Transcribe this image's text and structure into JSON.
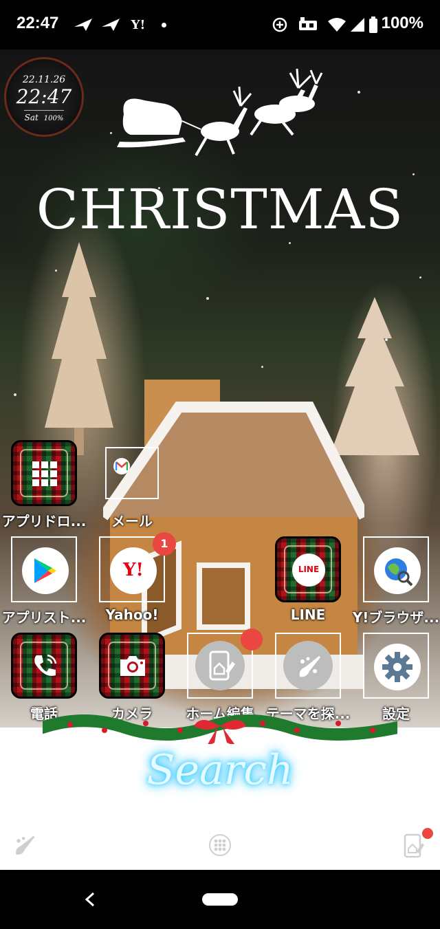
{
  "status_bar": {
    "time": "22:47",
    "left_icons": [
      "paper-plane-icon",
      "paper-plane-icon",
      "yahoo-icon",
      "dot-icon"
    ],
    "yahoo_text": "Y!",
    "right_icons": [
      "data-saver-icon",
      "vpn-icon",
      "wifi-icon",
      "signal-icon",
      "battery-icon"
    ],
    "battery": "100%"
  },
  "clock_widget": {
    "date": "22.11.26",
    "time": "22:47",
    "weekday": "Sat",
    "battery": "100%"
  },
  "wallpaper": {
    "title": "CHRISTMAS"
  },
  "apps": [
    {
      "id": "app-drawer",
      "label": "アプリドロ...",
      "icon": "grid-icon",
      "style": "plaid"
    },
    {
      "id": "mail",
      "label": "メール",
      "icon": "gmail-icon",
      "style": "framed"
    },
    {
      "id": "app-store",
      "label": "アプリスト...",
      "icon": "google-play-icon",
      "style": "framed"
    },
    {
      "id": "yahoo",
      "label": "Yahoo!",
      "icon": "yahoo-icon",
      "style": "framed",
      "badge": "1",
      "icon_text": "Y!"
    },
    {
      "id": "line",
      "label": "LINE",
      "icon": "line-icon",
      "style": "plaid",
      "icon_text": "LINE"
    },
    {
      "id": "y-browser",
      "label": "Y!ブラウザ...",
      "icon": "globe-search-icon",
      "style": "framed"
    },
    {
      "id": "phone",
      "label": "電話",
      "icon": "phone-icon",
      "style": "plaid"
    },
    {
      "id": "camera",
      "label": "カメラ",
      "icon": "camera-icon",
      "style": "plaid"
    },
    {
      "id": "home-edit",
      "label": "ホーム編集",
      "icon": "home-edit-icon",
      "style": "framed-grey"
    },
    {
      "id": "theme-search",
      "label": "テーマを探...",
      "icon": "brush-icon",
      "style": "framed-grey"
    },
    {
      "id": "settings",
      "label": "設定",
      "icon": "gear-icon",
      "style": "framed-grey"
    }
  ],
  "search_widget": {
    "label": "Search"
  },
  "dock": {
    "left_icon": "brush-icon",
    "center_icon": "app-drawer-dots-icon",
    "right_icon": "home-edit-icon"
  },
  "nav_bar": {
    "back_icon": "back-icon",
    "home_icon": "home-pill-icon"
  },
  "colors": {
    "badge": "#e9473f",
    "plaid_red": "#b3121b",
    "plaid_green": "#1f6b2e",
    "search_glow": "#3fd0ff"
  }
}
